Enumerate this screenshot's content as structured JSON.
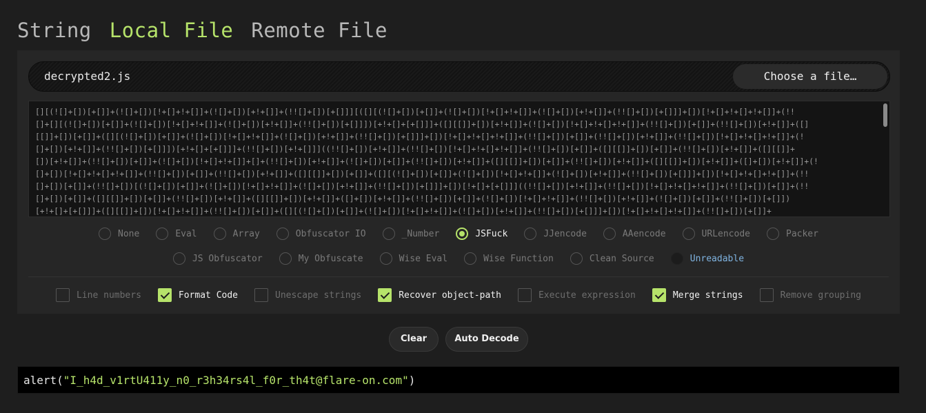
{
  "tabs": [
    "String",
    "Local File",
    "Remote File"
  ],
  "active_tab": "Local File",
  "file": {
    "name": "decrypted2.js",
    "choose_label": "Choose a file…"
  },
  "code_lines": [
    "[][(![]+[])[+[]]+(![]+[])[!+[]+!+[]]+(![]+[])[+!+[]]+(!![]+[])[+[]]][([][(![]+[])[+[]]+(![]+[])[!+[]+!+[]]+(![]+[])[+!+[]]+(!![]+[])[+[]]]+[])[!+[]+!+[]+!+[]]+(!!",
    "[]+[][(![]+[])[+[]]+(![]+[])[!+[]+!+[]]+(![]+[])[+!+[]]+(!![]+[])[+[]]])[+!+[]+[+[]]]+([][[]]+[])[+!+[]]+(![]+[])[!+[]+!+[]+!+[]]+(!![]+[])[+[]]+(!![]+[])[+!+[]]+([]",
    "[[]]+[])[+[]]+([][(![]+[])[+[]]+(![]+[])[!+[]+!+[]]+(![]+[])[+!+[]]+(!![]+[])[+[]]]+[])[!+[]+!+[]+!+[]]+(!![]+[])[+[]]+(!![]+[])[+!+[]]+(!![]+[])[!+[]+!+[]+!+[]]+(!",
    "[]+[])[+!+[]]+(!![]+[])[+[]]])[+!+[]+[+[]]]+(!![]+[])[+!+[]]]((!![]+[])[+!+[]]+(!![]+[])[!+[]+!+[]+!+[]]+(!![]+[])[+[]]+([][[]]+[])[+[]]+(!![]+[])[+!+[]]+([][[]]+",
    "[])[+!+[]]+(!![]+[])[+[]]+(![]+[])[!+[]+!+[]]+[]+(!![]+[])[+!+[]]+(![]+[])[+[]]+(!![]+[])[+!+[]]+([][[]]+[])[+[]]+(!![]+[])[+!+[]]+([][[]]+[])[+!+[]]+([]+[])[+!+[]]+(!",
    "[]+[])[!+[]+!+[]+!+[]]+(!![]+[])[+[]]+(!![]+[])[+!+[]]+([][[]]+[])[+[]]+([][(![]+[])[+[]]+(![]+[])[!+[]+!+[]]+(![]+[])[+!+[]]+(!![]+[])[+[]]]+[])[!+[]+!+[]+!+[]]+(!!",
    "[]+[])[+[]]+(!![]+[])[(![]+[])[+[]]+(![]+[])[!+[]+!+[]]+(![]+[])[+!+[]]+(!![]+[])[+[]]]+[])[!+[]+[+[]]]((!![]+[])[+!+[]]+(!![]+[])[!+[]+!+[]+!+[]]+(!![]+[])[+[]]+(!!",
    "[]+[])[+[]]+([][[]]+[])[+[]]+(!![]+[])[+!+[]]+([][[]]+[])[+!+[]]+([]+[])[+!+[]]+(!![]+[])[+[]]+(![]+[])[!+[]+!+[]]+(!![]+[])[+!+[]]+(![]+[])[+[]]+(!![]+[])[+[]])",
    "[+!+[]+[+[]]]+([][[]]+[])[!+[]+!+[]]+(!![]+[])[+[]]+([][(![]+[])[+[]]+(![]+[])[!+[]+!+[]]+(![]+[])[+!+[]]+(!![]+[])[+[]]]+[])[!+[]+!+[]+!+[]]+(!![]+[])[+[]]+"
  ],
  "decoders_row1": [
    "None",
    "Eval",
    "Array",
    "Obfuscator IO",
    "_Number",
    "JSFuck",
    "JJencode",
    "AAencode",
    "URLencode",
    "Packer"
  ],
  "decoders_row2": [
    "JS Obfuscator",
    "My Obfuscate",
    "Wise Eval",
    "Wise Function",
    "Clean Source",
    "Unreadable"
  ],
  "selected_decoder": "JSFuck",
  "options": [
    {
      "label": "Line numbers",
      "checked": false
    },
    {
      "label": "Format Code",
      "checked": true
    },
    {
      "label": "Unescape strings",
      "checked": false
    },
    {
      "label": "Recover object-path",
      "checked": true
    },
    {
      "label": "Execute expression",
      "checked": false
    },
    {
      "label": "Merge strings",
      "checked": true
    },
    {
      "label": "Remove grouping",
      "checked": false
    }
  ],
  "buttons": {
    "clear": "Clear",
    "auto_decode": "Auto Decode"
  },
  "output": {
    "prefix": "alert(",
    "string": "\"I_h4d_v1rtU411y_n0_r3h34rs4l_f0r_th4t@flare-on.com\"",
    "suffix": ")"
  },
  "colors": {
    "accent": "#b6e36a",
    "background": "#1e1e1e",
    "panel": "#262626",
    "special_label": "#7fb3e0"
  }
}
